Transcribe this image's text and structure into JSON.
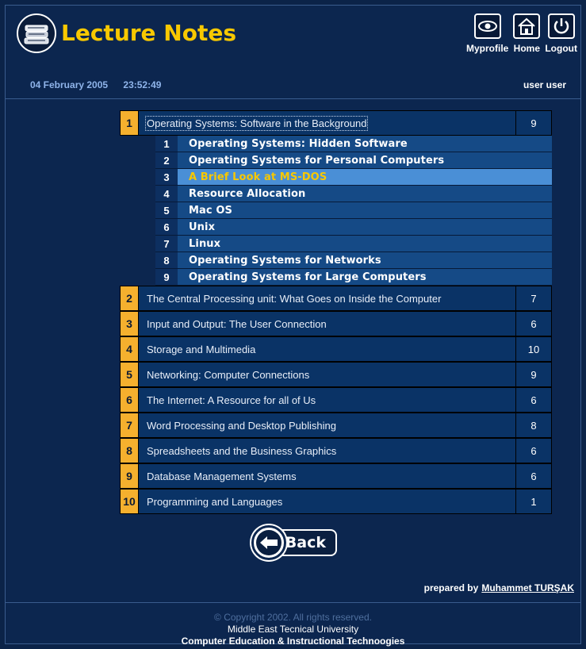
{
  "header": {
    "app_title": "Lecture Notes",
    "nav": [
      {
        "label": "Myprofile",
        "icon": "eye-icon"
      },
      {
        "label": "Home",
        "icon": "home-icon"
      },
      {
        "label": "Logout",
        "icon": "power-icon"
      }
    ]
  },
  "infobar": {
    "date": "04 February 2005",
    "time": "23:52:49",
    "user": "user user"
  },
  "chapters": [
    {
      "num": "1",
      "title": "Operating Systems: Software in the Background",
      "count": "9"
    },
    {
      "num": "2",
      "title": "The Central Processing unit: What Goes on Inside the Computer",
      "count": "7"
    },
    {
      "num": "3",
      "title": "Input and Output: The User Connection",
      "count": "6"
    },
    {
      "num": "4",
      "title": "Storage and Multimedia",
      "count": "10"
    },
    {
      "num": "5",
      "title": "Networking: Computer Connections",
      "count": "9"
    },
    {
      "num": "6",
      "title": "The Internet: A Resource for all of Us",
      "count": "6"
    },
    {
      "num": "7",
      "title": "Word Processing and Desktop Publishing",
      "count": "8"
    },
    {
      "num": "8",
      "title": "Spreadsheets and the Business Graphics",
      "count": "6"
    },
    {
      "num": "9",
      "title": "Database Management Systems",
      "count": "6"
    },
    {
      "num": "10",
      "title": "Programming and Languages",
      "count": "1"
    }
  ],
  "sections": [
    {
      "num": "1",
      "title": "Operating Systems: Hidden Software"
    },
    {
      "num": "2",
      "title": "Operating Systems for Personal Computers"
    },
    {
      "num": "3",
      "title": "A Brief Look at MS-DOS"
    },
    {
      "num": "4",
      "title": "Resource Allocation"
    },
    {
      "num": "5",
      "title": "Mac OS"
    },
    {
      "num": "6",
      "title": "Unix"
    },
    {
      "num": "7",
      "title": "Linux"
    },
    {
      "num": "8",
      "title": "Operating Systems for Networks"
    },
    {
      "num": "9",
      "title": "Operating Systems for Large Computers"
    }
  ],
  "selected_section": 3,
  "back_label": "Back",
  "prepared": {
    "prefix": "prepared by",
    "author": "Muhammet TURŞAK"
  },
  "footer": {
    "copyright": "© Copyright 2002. All rights reserved.",
    "org1": "Middle East Tecnical University",
    "org2": "Computer Education & Instructional Technoogies"
  },
  "colors": {
    "background": "#0c264f",
    "title_yellow": "#f8c800",
    "chapter_number_bg": "#f5b02e",
    "selected_section_bg": "#4a8fd6"
  }
}
